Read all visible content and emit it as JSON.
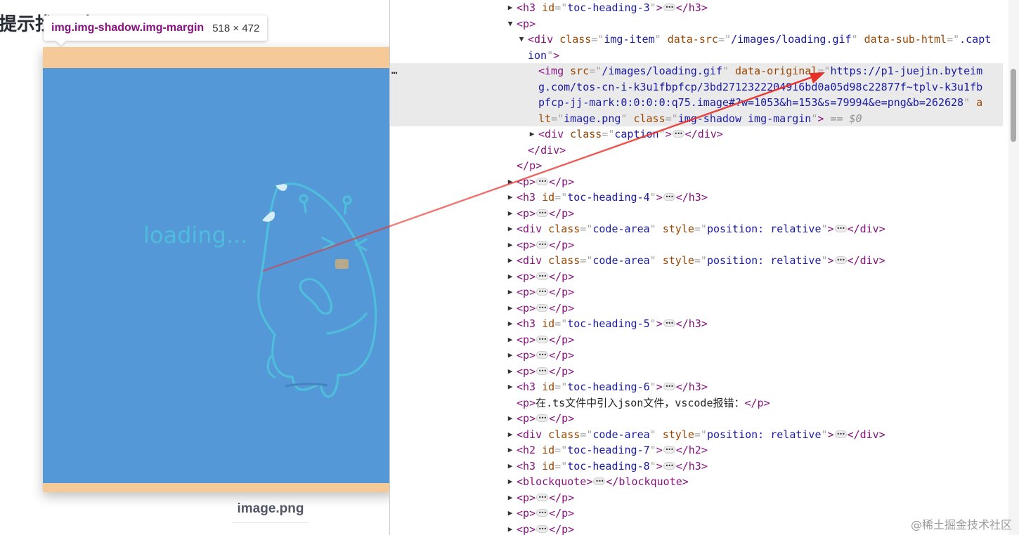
{
  "page": {
    "heading": "提示找不到...",
    "tooltip": {
      "selector": "img.img-shadow.img-margin",
      "size": "518 × 472"
    },
    "image_text": "loading...",
    "caption": "image.png",
    "colors": {
      "image_bg": "#5598d7",
      "highlight": "#f6c998",
      "art": "#4fc3dc"
    }
  },
  "devtools": {
    "selected_suffix": "== $0",
    "row_menu_icon": "…",
    "nodes": [
      {
        "tag": "h3",
        "attrs": [
          [
            "id",
            "toc-heading-3"
          ]
        ]
      },
      {
        "tag": "p"
      },
      {
        "tag": "div",
        "attrs": [
          [
            "class",
            "img-item"
          ],
          [
            "data-src",
            "/images/loading.gif"
          ],
          [
            "data-sub-html",
            ".caption"
          ]
        ]
      },
      {
        "tag": "img",
        "attrs": [
          [
            "src",
            "/images/loading.gif"
          ],
          [
            "data-original",
            "https://p1-juejin.byteimg.com/tos-cn-i-k3u1fbpfcp/3bd2712322204916bd0a05d98c22877f~tplv-k3u1fbpfcp-jj-mark:0:0:0:0:q75.image#?w=1053&h=153&s=79994&e=png&b=262628"
          ],
          [
            "alt",
            "image.png"
          ],
          [
            "class",
            "img-shadow img-margin"
          ]
        ]
      },
      {
        "tag": "div",
        "attrs": [
          [
            "class",
            "caption"
          ]
        ]
      },
      {
        "close": "div"
      },
      {
        "close": "p"
      },
      {
        "tag": "p"
      },
      {
        "tag": "h3",
        "attrs": [
          [
            "id",
            "toc-heading-4"
          ]
        ]
      },
      {
        "tag": "p"
      },
      {
        "tag": "div",
        "attrs": [
          [
            "class",
            "code-area"
          ],
          [
            "style",
            "position: relative"
          ]
        ]
      },
      {
        "tag": "p"
      },
      {
        "tag": "div",
        "attrs": [
          [
            "class",
            "code-area"
          ],
          [
            "style",
            "position: relative"
          ]
        ]
      },
      {
        "tag": "p"
      },
      {
        "tag": "p"
      },
      {
        "tag": "p"
      },
      {
        "tag": "h3",
        "attrs": [
          [
            "id",
            "toc-heading-5"
          ]
        ]
      },
      {
        "tag": "p"
      },
      {
        "tag": "p"
      },
      {
        "tag": "p"
      },
      {
        "tag": "h3",
        "attrs": [
          [
            "id",
            "toc-heading-6"
          ]
        ]
      },
      {
        "tag": "p",
        "text": "在.ts文件中引入json文件，vscode报错："
      },
      {
        "tag": "p"
      },
      {
        "tag": "div",
        "attrs": [
          [
            "class",
            "code-area"
          ],
          [
            "style",
            "position: relative"
          ]
        ]
      },
      {
        "tag": "h2",
        "attrs": [
          [
            "id",
            "toc-heading-7"
          ]
        ]
      },
      {
        "tag": "h3",
        "attrs": [
          [
            "id",
            "toc-heading-8"
          ]
        ]
      },
      {
        "tag": "blockquote"
      },
      {
        "tag": "p"
      },
      {
        "tag": "p"
      },
      {
        "tag": "p"
      }
    ]
  },
  "watermark": "@稀土掘金技术社区"
}
